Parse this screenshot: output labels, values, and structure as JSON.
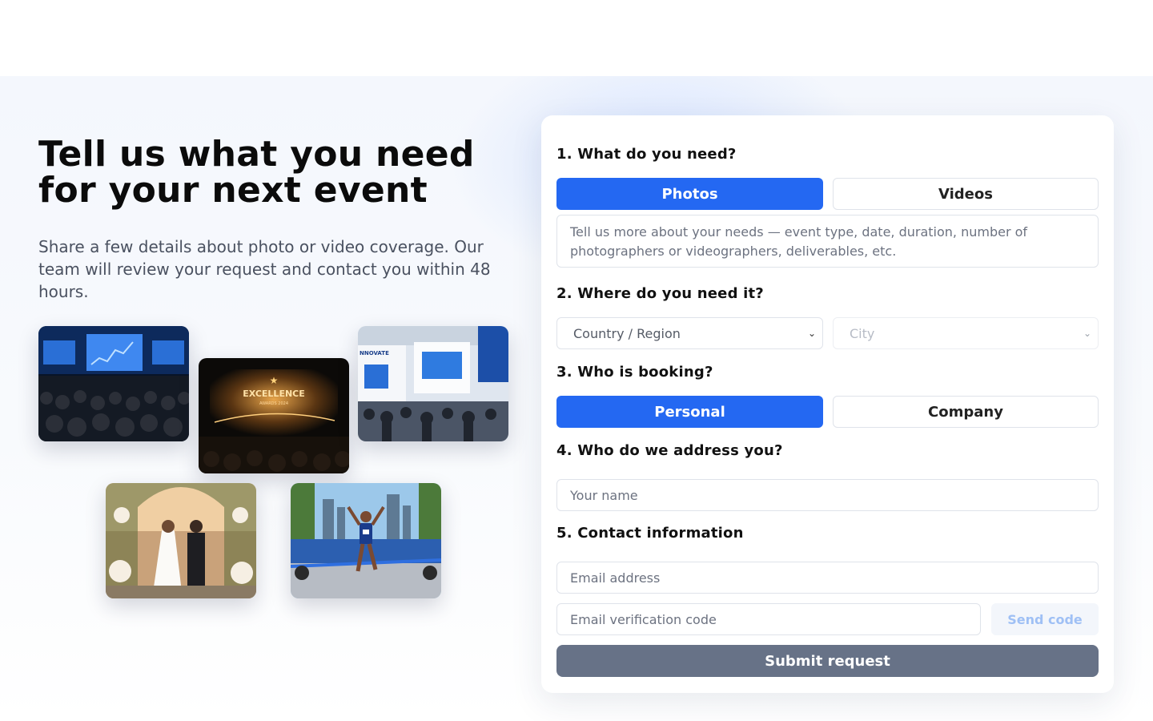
{
  "hero": {
    "headline_line1": "Tell us what you need",
    "headline_line2": "for your next event",
    "subtext": "Share a few details about photo or video coverage. Our team will review your request and contact you within 48 hours."
  },
  "gallery": [
    {
      "name": "conference-photo",
      "alt": "Conference keynote"
    },
    {
      "name": "awards-photo",
      "alt": "Awards ceremony",
      "sign_text": "EXCELLENCE",
      "sign_sub": "AWARDS 2024"
    },
    {
      "name": "expo-photo",
      "alt": "Exhibition hall",
      "sign_text": "NNOVATE"
    },
    {
      "name": "wedding-photo",
      "alt": "Wedding"
    },
    {
      "name": "marathon-photo",
      "alt": "Marathon finish"
    }
  ],
  "form": {
    "q1": "1. What do you need?",
    "need_options": [
      {
        "label": "Photos",
        "active": true
      },
      {
        "label": "Videos",
        "active": false
      }
    ],
    "details_placeholder": "Tell us more about your needs — event type, date, duration, number of photographers or videographers, deliverables, etc.",
    "q2": "2. Where do you need it?",
    "country_placeholder": "Country / Region",
    "city_placeholder": "City",
    "q3": "3. Who is booking?",
    "booking_options": [
      {
        "label": "Personal",
        "active": true
      },
      {
        "label": "Company",
        "active": false
      }
    ],
    "q4": "4. Who do we address you?",
    "name_placeholder": "Your name",
    "q5": "5. Contact information",
    "email_placeholder": "Email address",
    "code_placeholder": "Email verification code",
    "send_code_label": "Send code",
    "submit_label": "Submit request"
  },
  "colors": {
    "primary": "#2468f2",
    "submit_bg": "#677287",
    "heading": "#0b0b0b",
    "body_text": "#4a5160"
  },
  "icons": {
    "select_chevron": "chevron-down-icon"
  }
}
